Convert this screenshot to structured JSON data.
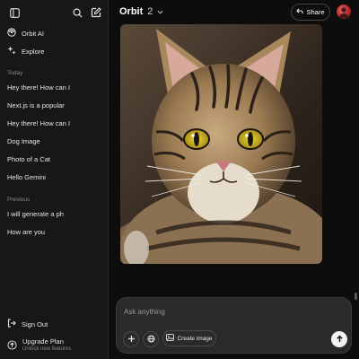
{
  "colors": {
    "background": "#0d0d0d",
    "sidebar": "#171717",
    "composer": "#2a2a2a",
    "accent_send": "#f2f2f2"
  },
  "sidebar": {
    "toggle_icon": "sidebar-toggle-icon",
    "search_icon": "search-icon",
    "new_chat_icon": "new-chat-icon",
    "brand": {
      "label": "Orbit AI",
      "icon": "orbit-logo-icon"
    },
    "explore": {
      "label": "Explore",
      "icon": "sparkle-icon"
    },
    "section_today": "Today",
    "today_chats": [
      "Hey there! How can I",
      "Next.js is a popular",
      "Hey there! How can I",
      "Dog Image",
      "Photo of a Cat",
      "Hello Gemini"
    ],
    "section_previous": "Previous",
    "previous_chats": [
      "I will generate a ph",
      "How are you"
    ],
    "sign_out": {
      "label": "Sign Out",
      "icon": "sign-out-icon"
    },
    "upgrade": {
      "label": "Upgrade Plan",
      "sub": "Unlock new features",
      "icon": "upgrade-icon"
    }
  },
  "header": {
    "model_name": "Orbit",
    "model_version": "2",
    "dropdown_icon": "chevron-down-icon",
    "share_label": "Share",
    "share_icon": "share-arrow-icon"
  },
  "composer": {
    "placeholder": "Ask anything",
    "value": "",
    "add_icon": "plus-icon",
    "web_icon": "globe-icon",
    "create_image_label": "Create image",
    "create_image_icon": "image-icon",
    "send_icon": "arrow-up-icon"
  }
}
